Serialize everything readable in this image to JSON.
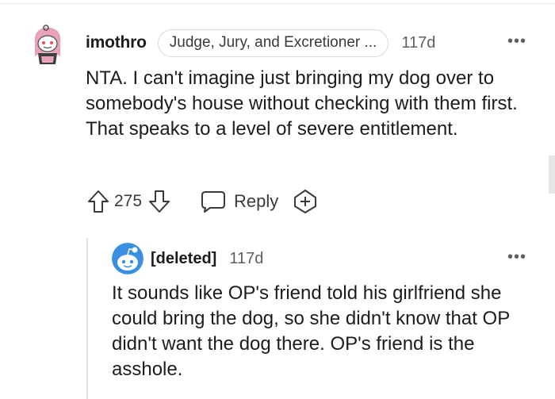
{
  "comment": {
    "username": "imothro",
    "flair": "Judge, Jury, and Excretioner ...",
    "age": "117d",
    "more": "•••",
    "body": "NTA. I can't imagine just bringing my dog over to somebody's house without checking with them first. That speaks to a level of severe entitlement.",
    "votes": "275",
    "reply_label": "Reply",
    "avatar_icon": "snoo-avatar-pink-hood",
    "upvote_icon": "arrow-up-outline",
    "downvote_icon": "arrow-down-outline",
    "reply_icon": "speech-bubble",
    "award_icon": "award-plus"
  },
  "reply": {
    "username": "[deleted]",
    "age": "117d",
    "more": "•••",
    "body": "It sounds like OP's friend told his girlfriend she could bring the dog, so she didn't know that OP didn't want the dog there. OP's friend is the asshole.",
    "avatar_icon": "snoo-avatar-default"
  },
  "colors": {
    "text": "#1c1c1c",
    "meta": "#5f5f5f",
    "icon": "#3a3a3a",
    "border": "#d9dadc",
    "thread_line": "#e0e2e4",
    "avatar_pink": "#e8a3b9",
    "avatar_blue": "#3b8fe0"
  }
}
